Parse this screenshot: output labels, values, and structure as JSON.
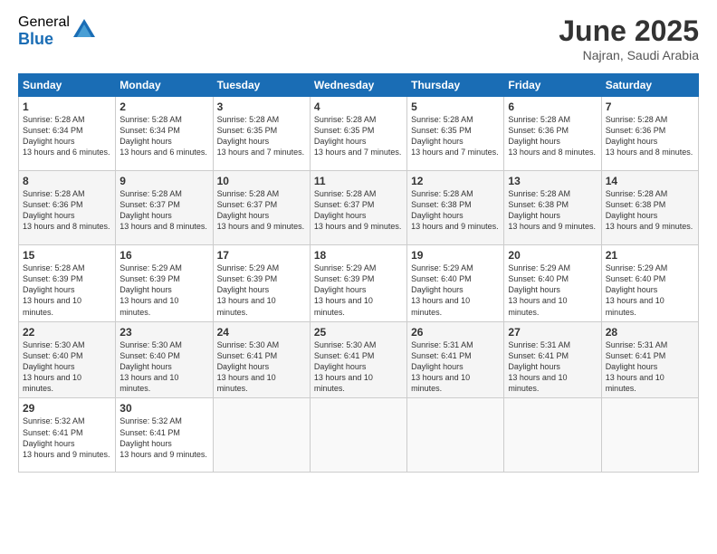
{
  "header": {
    "logo_general": "General",
    "logo_blue": "Blue",
    "month_year": "June 2025",
    "location": "Najran, Saudi Arabia"
  },
  "calendar": {
    "days_of_week": [
      "Sunday",
      "Monday",
      "Tuesday",
      "Wednesday",
      "Thursday",
      "Friday",
      "Saturday"
    ],
    "weeks": [
      [
        {
          "day": "1",
          "sunrise": "5:28 AM",
          "sunset": "6:34 PM",
          "daylight": "13 hours and 6 minutes."
        },
        {
          "day": "2",
          "sunrise": "5:28 AM",
          "sunset": "6:34 PM",
          "daylight": "13 hours and 6 minutes."
        },
        {
          "day": "3",
          "sunrise": "5:28 AM",
          "sunset": "6:35 PM",
          "daylight": "13 hours and 7 minutes."
        },
        {
          "day": "4",
          "sunrise": "5:28 AM",
          "sunset": "6:35 PM",
          "daylight": "13 hours and 7 minutes."
        },
        {
          "day": "5",
          "sunrise": "5:28 AM",
          "sunset": "6:35 PM",
          "daylight": "13 hours and 7 minutes."
        },
        {
          "day": "6",
          "sunrise": "5:28 AM",
          "sunset": "6:36 PM",
          "daylight": "13 hours and 8 minutes."
        },
        {
          "day": "7",
          "sunrise": "5:28 AM",
          "sunset": "6:36 PM",
          "daylight": "13 hours and 8 minutes."
        }
      ],
      [
        {
          "day": "8",
          "sunrise": "5:28 AM",
          "sunset": "6:36 PM",
          "daylight": "13 hours and 8 minutes."
        },
        {
          "day": "9",
          "sunrise": "5:28 AM",
          "sunset": "6:37 PM",
          "daylight": "13 hours and 8 minutes."
        },
        {
          "day": "10",
          "sunrise": "5:28 AM",
          "sunset": "6:37 PM",
          "daylight": "13 hours and 9 minutes."
        },
        {
          "day": "11",
          "sunrise": "5:28 AM",
          "sunset": "6:37 PM",
          "daylight": "13 hours and 9 minutes."
        },
        {
          "day": "12",
          "sunrise": "5:28 AM",
          "sunset": "6:38 PM",
          "daylight": "13 hours and 9 minutes."
        },
        {
          "day": "13",
          "sunrise": "5:28 AM",
          "sunset": "6:38 PM",
          "daylight": "13 hours and 9 minutes."
        },
        {
          "day": "14",
          "sunrise": "5:28 AM",
          "sunset": "6:38 PM",
          "daylight": "13 hours and 9 minutes."
        }
      ],
      [
        {
          "day": "15",
          "sunrise": "5:28 AM",
          "sunset": "6:39 PM",
          "daylight": "13 hours and 10 minutes."
        },
        {
          "day": "16",
          "sunrise": "5:29 AM",
          "sunset": "6:39 PM",
          "daylight": "13 hours and 10 minutes."
        },
        {
          "day": "17",
          "sunrise": "5:29 AM",
          "sunset": "6:39 PM",
          "daylight": "13 hours and 10 minutes."
        },
        {
          "day": "18",
          "sunrise": "5:29 AM",
          "sunset": "6:39 PM",
          "daylight": "13 hours and 10 minutes."
        },
        {
          "day": "19",
          "sunrise": "5:29 AM",
          "sunset": "6:40 PM",
          "daylight": "13 hours and 10 minutes."
        },
        {
          "day": "20",
          "sunrise": "5:29 AM",
          "sunset": "6:40 PM",
          "daylight": "13 hours and 10 minutes."
        },
        {
          "day": "21",
          "sunrise": "5:29 AM",
          "sunset": "6:40 PM",
          "daylight": "13 hours and 10 minutes."
        }
      ],
      [
        {
          "day": "22",
          "sunrise": "5:30 AM",
          "sunset": "6:40 PM",
          "daylight": "13 hours and 10 minutes."
        },
        {
          "day": "23",
          "sunrise": "5:30 AM",
          "sunset": "6:40 PM",
          "daylight": "13 hours and 10 minutes."
        },
        {
          "day": "24",
          "sunrise": "5:30 AM",
          "sunset": "6:41 PM",
          "daylight": "13 hours and 10 minutes."
        },
        {
          "day": "25",
          "sunrise": "5:30 AM",
          "sunset": "6:41 PM",
          "daylight": "13 hours and 10 minutes."
        },
        {
          "day": "26",
          "sunrise": "5:31 AM",
          "sunset": "6:41 PM",
          "daylight": "13 hours and 10 minutes."
        },
        {
          "day": "27",
          "sunrise": "5:31 AM",
          "sunset": "6:41 PM",
          "daylight": "13 hours and 10 minutes."
        },
        {
          "day": "28",
          "sunrise": "5:31 AM",
          "sunset": "6:41 PM",
          "daylight": "13 hours and 10 minutes."
        }
      ],
      [
        {
          "day": "29",
          "sunrise": "5:32 AM",
          "sunset": "6:41 PM",
          "daylight": "13 hours and 9 minutes."
        },
        {
          "day": "30",
          "sunrise": "5:32 AM",
          "sunset": "6:41 PM",
          "daylight": "13 hours and 9 minutes."
        },
        null,
        null,
        null,
        null,
        null
      ]
    ]
  }
}
